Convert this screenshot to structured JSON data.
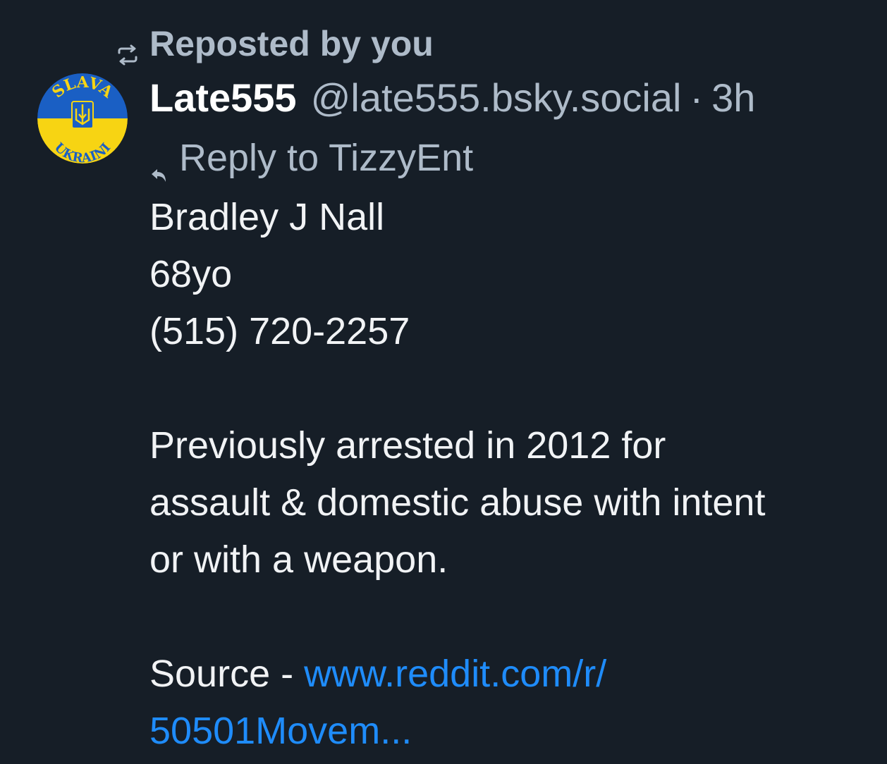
{
  "repost": {
    "label": "Reposted by you",
    "icon": "repost-icon"
  },
  "avatar": {
    "top_text": "SLAVA",
    "bottom_text": "UKRAINI",
    "colors": {
      "top": "#1a5fc4",
      "bottom": "#f7d413",
      "text": "#f7d413",
      "bottom_text": "#1a5fc4"
    }
  },
  "author": {
    "name": "Late555",
    "handle": "@late555.bsky.social",
    "separator": "·",
    "time": "3h"
  },
  "reply": {
    "label": "Reply to TizzyEnt",
    "icon": "reply-icon"
  },
  "body": {
    "lines_1": [
      "Bradley J Nall",
      "68yo",
      "(515) 720-2257"
    ],
    "lines_2": [
      "Previously arrested in 2012 for",
      "assault & domestic abuse with intent",
      "or with a weapon."
    ],
    "source_prefix": "Source - ",
    "link_line_1": "www.reddit.com/r/",
    "link_line_2": "50501Movem..."
  },
  "colors": {
    "background": "#161e27",
    "text": "#f1f3f5",
    "muted": "#aebbc9",
    "link": "#1f8cfa"
  }
}
